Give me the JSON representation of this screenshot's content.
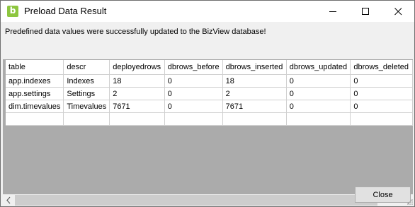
{
  "window": {
    "title": "Preload Data Result",
    "icon": "b-logo-icon",
    "accent_color": "#8dc63f"
  },
  "message": "Predefined data values were successfully updated to the BizView database!",
  "table": {
    "columns": [
      "table",
      "descr",
      "deployedrows",
      "dbrows_before",
      "dbrows_inserted",
      "dbrows_updated",
      "dbrows_deleted"
    ],
    "rows": [
      [
        "app.indexes",
        "Indexes",
        "18",
        "0",
        "18",
        "0",
        "0"
      ],
      [
        "app.settings",
        "Settings",
        "2",
        "0",
        "2",
        "0",
        "0"
      ],
      [
        "dim.timevalues",
        "Timevalues",
        "7671",
        "0",
        "7671",
        "0",
        "0"
      ],
      [
        "",
        "",
        "",
        "",
        "",
        "",
        ""
      ]
    ]
  },
  "buttons": {
    "close_label": "Close"
  }
}
